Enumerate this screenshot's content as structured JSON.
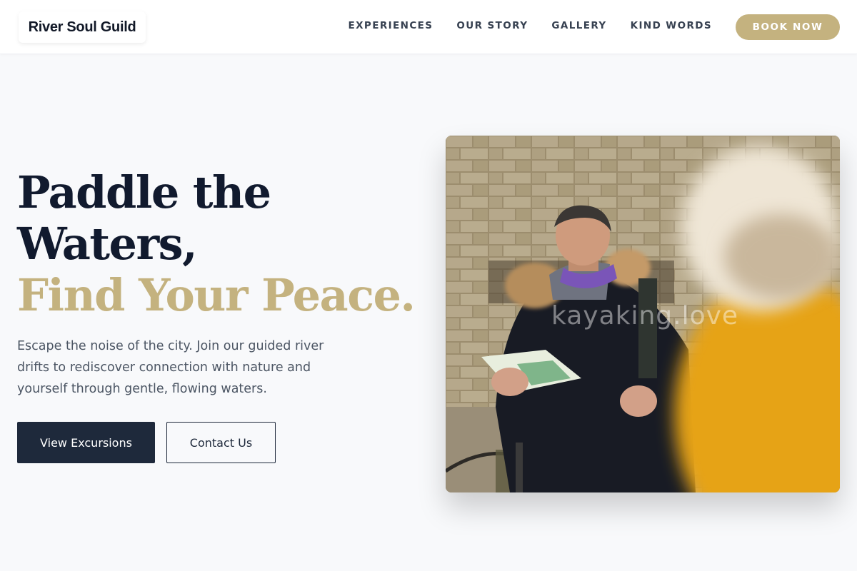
{
  "header": {
    "logo": "River Soul Guild",
    "nav": [
      "Experiences",
      "Our Story",
      "Gallery",
      "Kind Words"
    ],
    "book_label": "Book Now"
  },
  "hero": {
    "title_line1": "Paddle the",
    "title_line2": "Waters,",
    "title_accent": "Find Your Peace.",
    "description": "Escape the noise of the city. Join our guided river drifts to rediscover connection with nature and yourself through gentle, flowing waters.",
    "primary_button": "View Excursions",
    "secondary_button": "Contact Us",
    "image_watermark": "kayaking.love"
  },
  "colors": {
    "accent": "#c4b27f",
    "navy": "#1e293b",
    "heading": "#111a2e",
    "background": "#f8f9fb"
  }
}
